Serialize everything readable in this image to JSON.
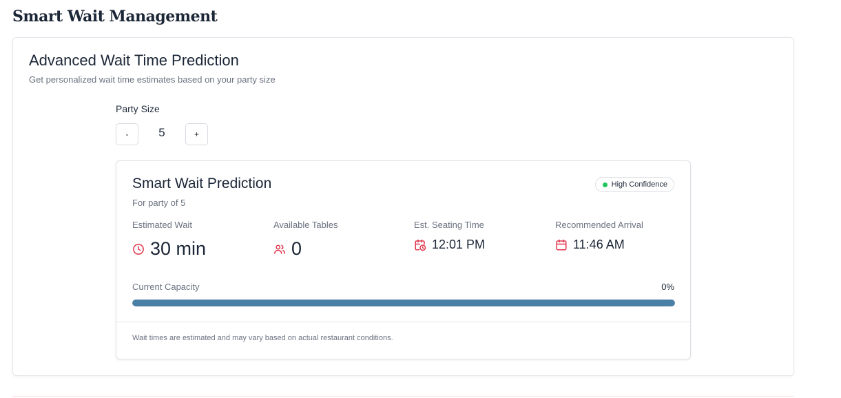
{
  "page": {
    "title": "Smart Wait Management"
  },
  "section": {
    "title": "Advanced Wait Time Prediction",
    "subtitle": "Get personalized wait time estimates based on your party size"
  },
  "party": {
    "label": "Party Size",
    "minus_label": "-",
    "plus_label": "+",
    "value": "5"
  },
  "prediction": {
    "title": "Smart Wait Prediction",
    "subtitle": "For party of 5",
    "confidence": "High Confidence",
    "stats": {
      "wait": {
        "label": "Estimated Wait",
        "value": "30 min",
        "icon": "clock-icon"
      },
      "tables": {
        "label": "Available Tables",
        "value": "0",
        "icon": "users-icon"
      },
      "seating": {
        "label": "Est. Seating Time",
        "value": "12:01 PM",
        "icon": "calendar-clock-icon"
      },
      "arrival": {
        "label": "Recommended Arrival",
        "value": "11:46 AM",
        "icon": "calendar-icon"
      }
    },
    "capacity": {
      "label": "Current Capacity",
      "percent_text": "0%",
      "bar_fill_fraction": 1.0
    },
    "disclaimer": "Wait times are estimated and may vary based on actual restaurant conditions."
  },
  "colors": {
    "accent_icon": "#e0344a",
    "bar": "#4a7fa6",
    "confidence_dot": "#22c55e"
  }
}
